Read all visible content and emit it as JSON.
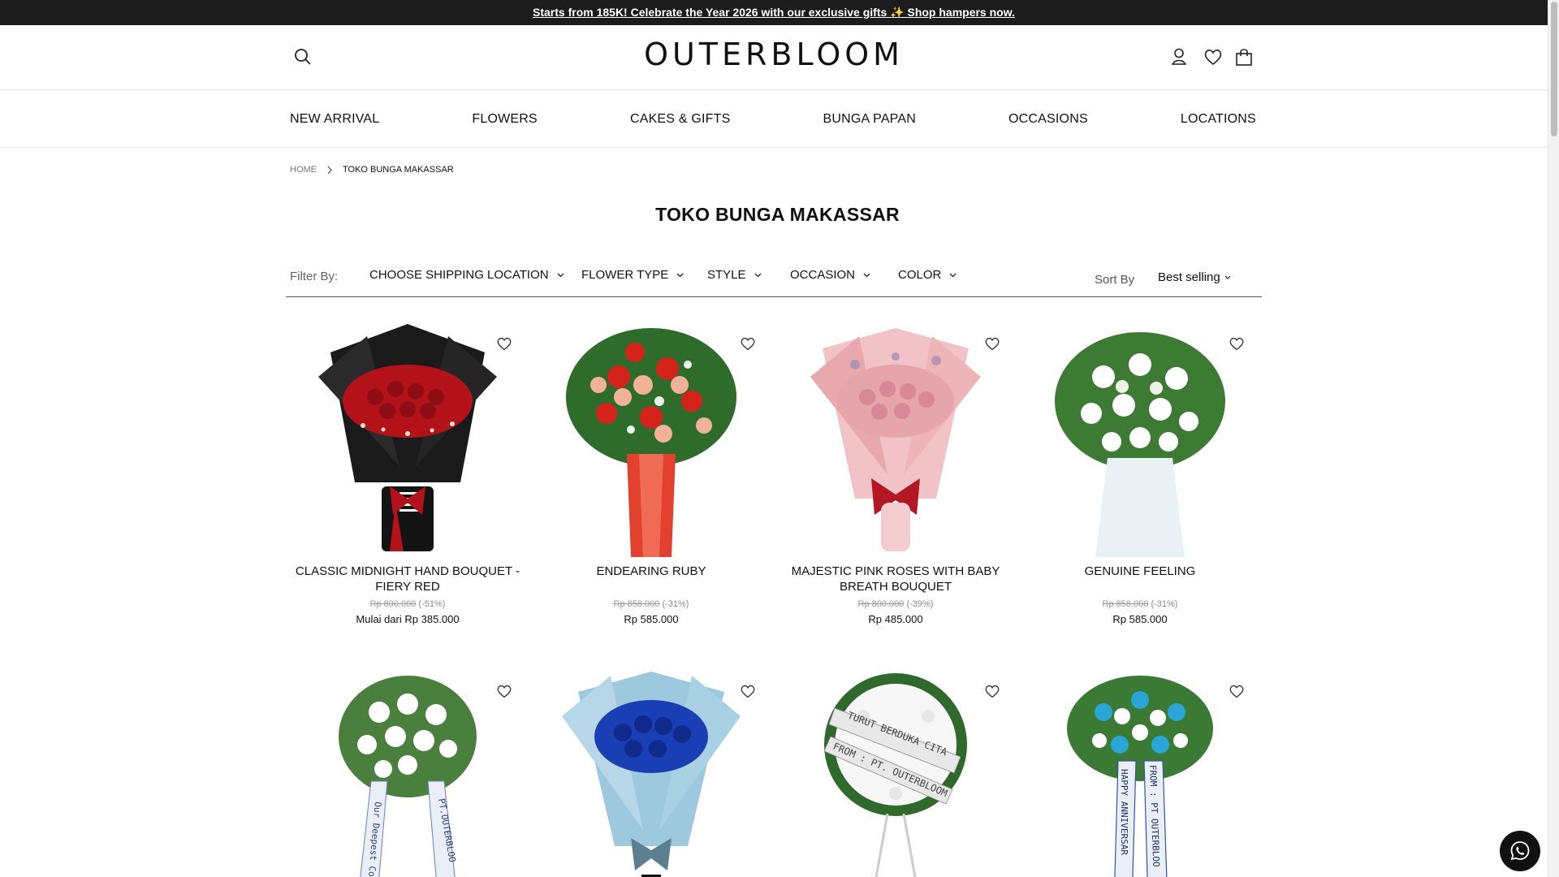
{
  "announcement": {
    "text": "Starts from 185K! Celebrate the Year 2026 with our exclusive gifts ✨ Shop hampers now."
  },
  "header": {
    "logo": "OUTERBLOOM",
    "icons": [
      "search-icon",
      "user-icon",
      "heart-icon",
      "bag-icon"
    ]
  },
  "nav": {
    "items": [
      "NEW ARRIVAL",
      "FLOWERS",
      "CAKES & GIFTS",
      "BUNGA PAPAN",
      "OCCASIONS",
      "LOCATIONS"
    ]
  },
  "breadcrumb": {
    "home": "HOME",
    "current": "TOKO BUNGA MAKASSAR"
  },
  "page": {
    "title": "TOKO BUNGA MAKASSAR"
  },
  "filters": {
    "label": "Filter By:",
    "items": [
      "CHOOSE SHIPPING LOCATION",
      "FLOWER TYPE",
      "STYLE",
      "OCCASION",
      "COLOR"
    ],
    "sort_label": "Sort By",
    "sort_value": "Best selling"
  },
  "products": [
    {
      "name": "CLASSIC MIDNIGHT HAND BOUQUET - FIERY RED",
      "old_price": "Rp 800.000",
      "discount": "(-51%)",
      "price_prefix": "Mulai dari",
      "price": "Rp 385.000"
    },
    {
      "name": "ENDEARING RUBY",
      "old_price": "Rp 858.000",
      "discount": "(-31%)",
      "price_prefix": "",
      "price": "Rp 585.000"
    },
    {
      "name": "MAJESTIC PINK ROSES WITH BABY BREATH BOUQUET",
      "old_price": "Rp 800.000",
      "discount": "(-39%)",
      "price_prefix": "",
      "price": "Rp 485.000"
    },
    {
      "name": "GENUINE FEELING",
      "old_price": "Rp 858.000",
      "discount": "(-31%)",
      "price_prefix": "",
      "price": "Rp 585.000"
    },
    {
      "name": "",
      "ribbon": [
        "Our Deepest Condole",
        "PT.OUTERBLOO"
      ]
    },
    {
      "name": ""
    },
    {
      "name": "",
      "ribbon": [
        "TURUT BERDUKA CITA",
        "FROM : PT. OUTERBLOOM"
      ]
    },
    {
      "name": "",
      "ribbon": [
        "HAPPY ANNIVERSAR",
        "FROM : PT OUTERBLOO"
      ]
    }
  ],
  "colors": {
    "announce_bg": "#1c1c1c",
    "accent": "#111111",
    "whatsapp": "#111111"
  }
}
